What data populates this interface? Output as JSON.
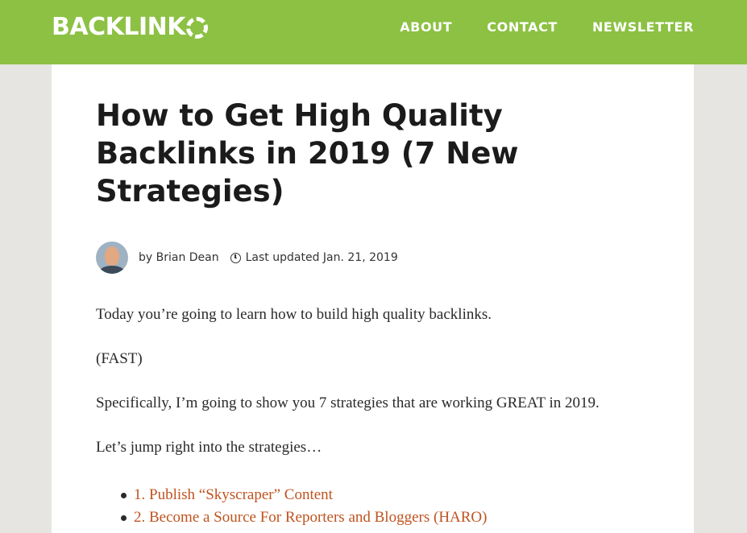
{
  "header": {
    "logo_text": "BACKLINK",
    "nav": [
      {
        "label": "ABOUT"
      },
      {
        "label": "CONTACT"
      },
      {
        "label": "NEWSLETTER"
      }
    ]
  },
  "article": {
    "title": "How to Get High Quality Backlinks in 2019 (7 New Strategies)",
    "author": "by Brian Dean",
    "updated": "Last updated Jan. 21, 2019",
    "paragraphs": [
      "Today you’re going to learn how to build high quality backlinks.",
      "(FAST)",
      "Specifically, I’m going to show you 7 strategies that are working GREAT in 2019.",
      "Let’s jump right into the strategies…"
    ],
    "toc": [
      {
        "label": "1. Publish “Skyscraper” Content"
      },
      {
        "label": "2. Become a Source For Reporters and Bloggers (HARO)"
      }
    ]
  },
  "colors": {
    "brand_green": "#8cc143",
    "link_orange": "#c0531f",
    "page_bg": "#e6e5e1"
  },
  "icons": [
    "logo-ring-icon",
    "clock-icon",
    "author-avatar"
  ]
}
